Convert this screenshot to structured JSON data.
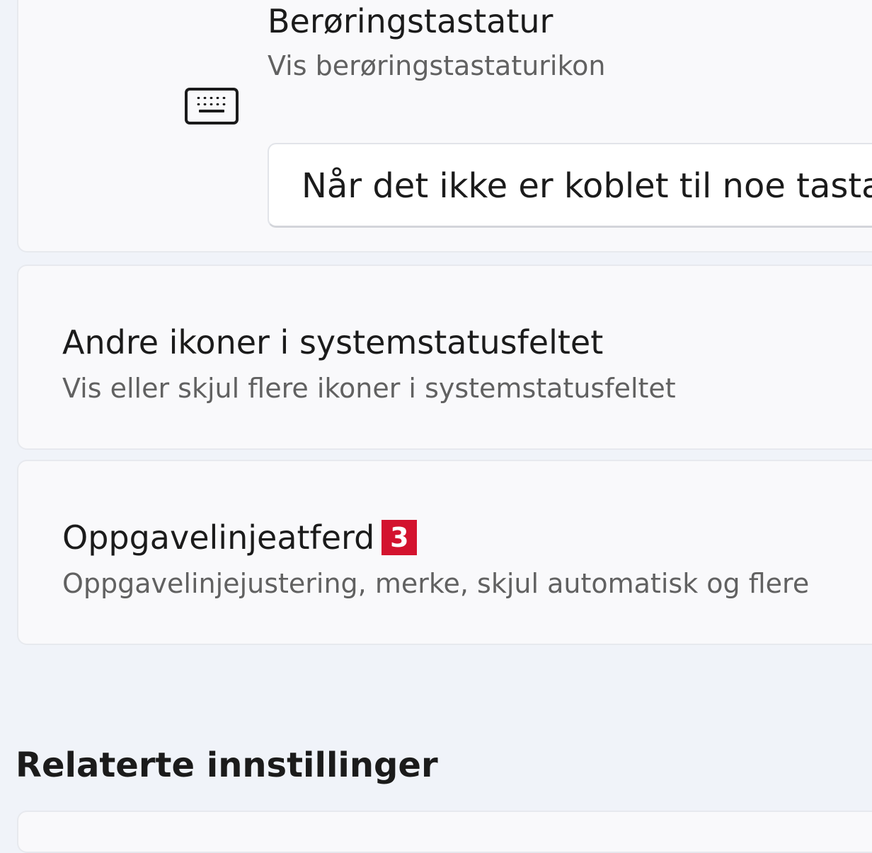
{
  "touch_keyboard": {
    "title": "Berøringstastatur",
    "subtitle": "Vis berøringstastaturikon",
    "icon": "keyboard-icon",
    "dropdown_value": "Når det ikke er koblet til noe tasta"
  },
  "other_icons": {
    "title": "Andre ikoner i systemstatusfeltet",
    "subtitle": "Vis eller skjul flere ikoner i systemstatusfeltet"
  },
  "taskbar_behavior": {
    "title": "Oppgavelinjeatferd",
    "badge": "3",
    "subtitle": "Oppgavelinjejustering, merke, skjul automatisk og flere"
  },
  "related": {
    "heading": "Relaterte innstillinger"
  },
  "colors": {
    "background": "#f0f3f9",
    "card": "#f9f9fb",
    "badge": "#d3132e",
    "secondary_text": "#616161"
  }
}
